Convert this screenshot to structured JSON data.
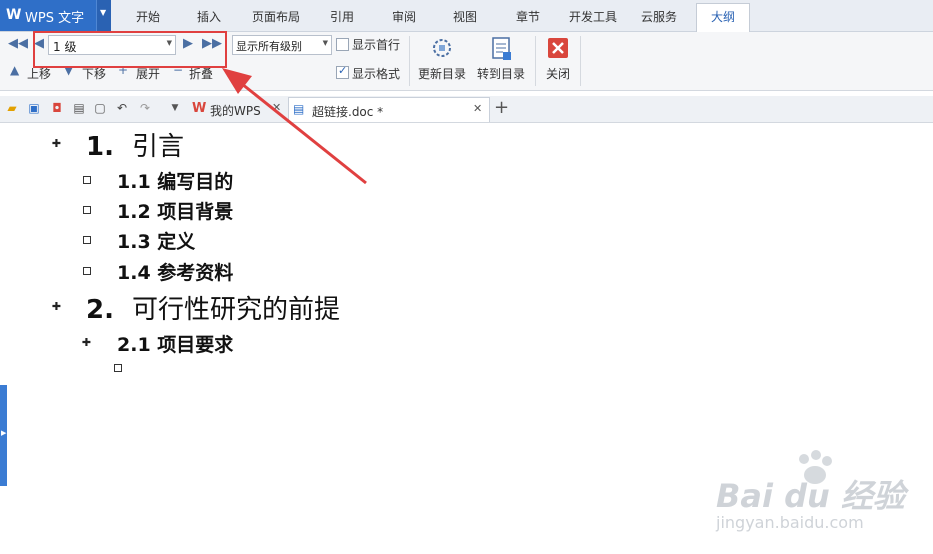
{
  "app": {
    "title": "WPS 文字"
  },
  "menu_tabs": [
    "开始",
    "插入",
    "页面布局",
    "引用",
    "审阅",
    "视图",
    "章节",
    "开发工具",
    "云服务",
    "大纲"
  ],
  "ribbon": {
    "level_value": "1 级",
    "show_levels_value": "显示所有级别",
    "show_first_line": "显示首行",
    "show_format": "显示格式",
    "show_first_line_checked": false,
    "show_format_checked": true,
    "move_up": "上移",
    "move_down": "下移",
    "expand": "展开",
    "collapse": "折叠",
    "update_toc": "更新目录",
    "goto_toc": "转到目录",
    "close": "关闭"
  },
  "doc_tabs": [
    {
      "label": "我的WPS"
    },
    {
      "label": "超链接.doc *"
    }
  ],
  "outline": {
    "h1_1_num": "1.",
    "h1_1_text": "引言",
    "h2_items": [
      "1.1 编写目的",
      "1.2 项目背景",
      "1.3 定义",
      "1.4 参考资料"
    ],
    "h1_2_num": "2.",
    "h1_2_text": "可行性研究的前提",
    "h2_2_1": "2.1 项目要求"
  },
  "watermark": {
    "brand": "Bai du 经验",
    "url": "jingyan.baidu.com"
  },
  "colors": {
    "accent": "#2f6fc8",
    "annotation": "#e04040"
  }
}
